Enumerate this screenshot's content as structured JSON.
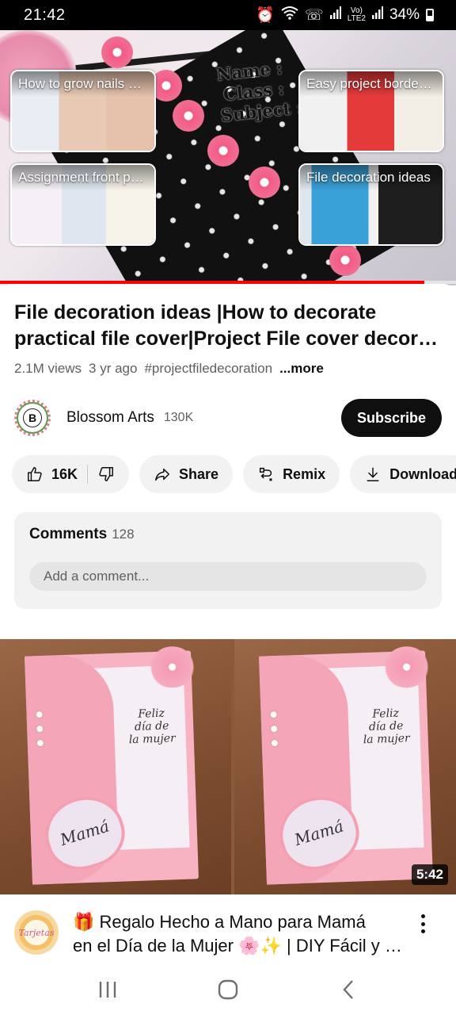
{
  "status_bar": {
    "time": "21:42",
    "network_label_top": "Vo)",
    "network_label_bottom": "LTE2",
    "battery": "34%"
  },
  "player": {
    "overlay_text": [
      "Name :",
      "Class :",
      "Subject :"
    ],
    "progress_fraction": 0.93,
    "end_cards": [
      {
        "title": "How to grow nails naturally"
      },
      {
        "title": "Assignment front page design"
      },
      {
        "title": "Easy project border design"
      },
      {
        "title": "File decoration ideas"
      }
    ]
  },
  "video": {
    "title_line1": "File decoration ideas |How to decorate",
    "title_line2": "practical file cover|Project File cover decoration",
    "views": "2.1M views",
    "age": "3 yr ago",
    "hashtag": "#projectfiledecoration",
    "more": "...more"
  },
  "channel": {
    "avatar_letter": "B",
    "name": "Blossom Arts",
    "subscribers": "130K",
    "subscribe_label": "Subscribe"
  },
  "actions": {
    "like_count": "16K",
    "share_label": "Share",
    "remix_label": "Remix",
    "download_label": "Download"
  },
  "comments": {
    "label": "Comments",
    "count": "128",
    "placeholder": "Add a comment..."
  },
  "next_video": {
    "card_text": [
      "Feliz",
      "día de",
      "la mujer"
    ],
    "heart_text": "Mamá",
    "duration": "5:42",
    "avatar_text": "Tarjetas",
    "title_line1": "🎁 Regalo Hecho a Mano para Mamá",
    "title_line2": "en el Día de la Mujer 🌸✨ | DIY Fácil y Bonito"
  }
}
